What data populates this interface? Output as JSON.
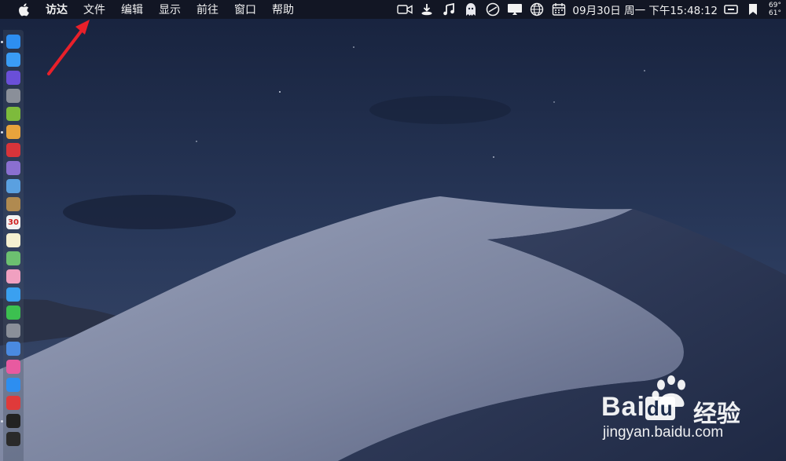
{
  "menubar": {
    "apple_icon": "apple-logo-icon",
    "items": [
      "访达",
      "文件",
      "编辑",
      "显示",
      "前往",
      "窗口",
      "帮助"
    ]
  },
  "status": {
    "icons": [
      "video-camera-icon",
      "download-icon",
      "music-note-icon",
      "ghost-icon",
      "sync-icon",
      "display-icon",
      "globe-icon",
      "calendar-icon"
    ],
    "clock": "09月30日 周一 下午15:48:12",
    "temps": [
      "69°",
      "61°"
    ]
  },
  "dock": {
    "icons": [
      "finder-icon",
      "safari-icon",
      "siri-icon",
      "launchpad-icon",
      "android-icon",
      "chrome-icon",
      "app-red-icon",
      "calculator-icon",
      "preview-icon",
      "notes-brown-icon",
      "calendar-app-icon",
      "notes-icon",
      "maps-icon",
      "photos-icon",
      "messages-icon",
      "facetime-icon",
      "system-preferences-icon",
      "keynote-icon",
      "itunes-icon",
      "app-store-icon",
      "vivaldi-icon",
      "terminal-icon",
      "activity-monitor-icon"
    ],
    "calendar_day": "30"
  },
  "watermark": {
    "brand": "Bai",
    "brand_tail": "du",
    "suffix": "经验",
    "url": "jingyan.baidu.com"
  },
  "colors": {
    "accent_arrow": "#e8202a",
    "sky_top": "#1a2540",
    "sky_bottom": "#3a4868",
    "dune": "#8a93ac"
  }
}
